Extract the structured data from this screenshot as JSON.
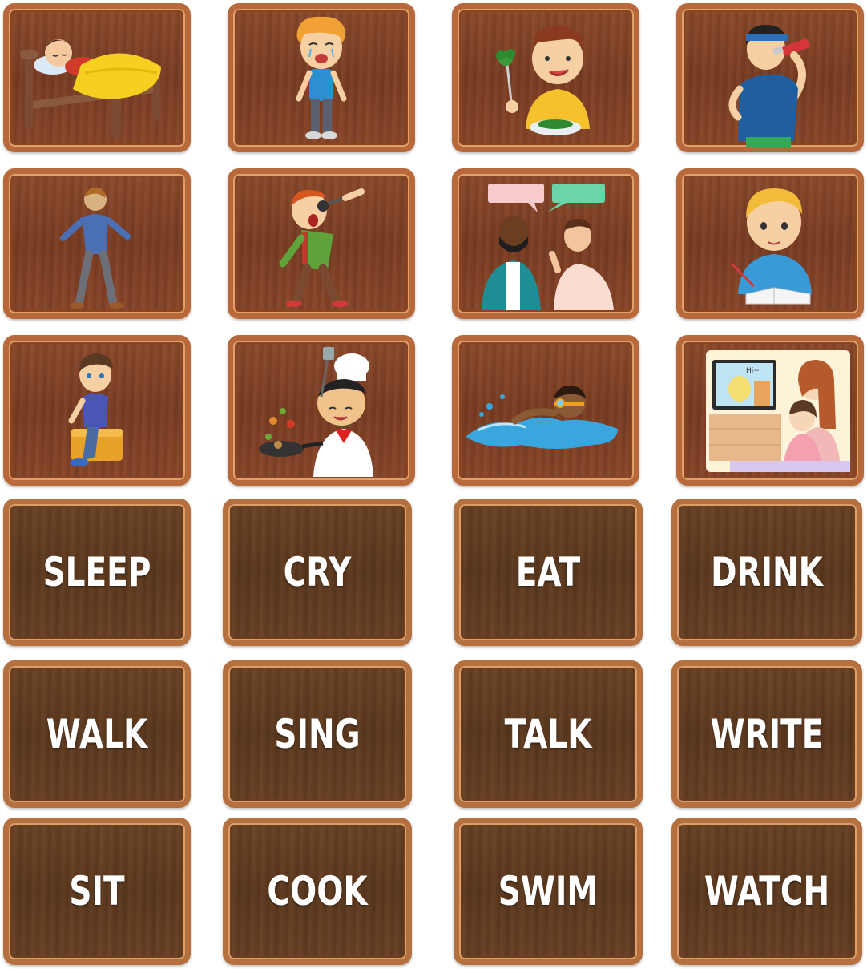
{
  "picture_cards": [
    {
      "action": "sleep",
      "icon": "sleeping-boy-icon"
    },
    {
      "action": "cry",
      "icon": "crying-boy-icon"
    },
    {
      "action": "eat",
      "icon": "eating-boy-icon"
    },
    {
      "action": "drink",
      "icon": "drinking-boy-icon"
    },
    {
      "action": "walk",
      "icon": "walking-boy-icon"
    },
    {
      "action": "sing",
      "icon": "singing-boy-icon"
    },
    {
      "action": "talk",
      "icon": "talking-men-icon"
    },
    {
      "action": "write",
      "icon": "writing-boy-icon"
    },
    {
      "action": "sit",
      "icon": "sitting-boy-icon"
    },
    {
      "action": "cook",
      "icon": "cooking-chef-icon"
    },
    {
      "action": "swim",
      "icon": "swimming-boy-icon"
    },
    {
      "action": "watch",
      "icon": "watching-tv-icon"
    }
  ],
  "word_cards": [
    {
      "label": "SLEEP"
    },
    {
      "label": "CRY"
    },
    {
      "label": "EAT"
    },
    {
      "label": "DRINK"
    },
    {
      "label": "WALK"
    },
    {
      "label": "SING"
    },
    {
      "label": "TALK"
    },
    {
      "label": "WRITE"
    },
    {
      "label": "SIT"
    },
    {
      "label": "COOK"
    },
    {
      "label": "SWIM"
    },
    {
      "label": "WATCH"
    }
  ],
  "colors": {
    "picture_wood": "#7e3f24",
    "word_wood": "#603b20",
    "frame": "#b8693c",
    "word_text": "#ffffff"
  }
}
